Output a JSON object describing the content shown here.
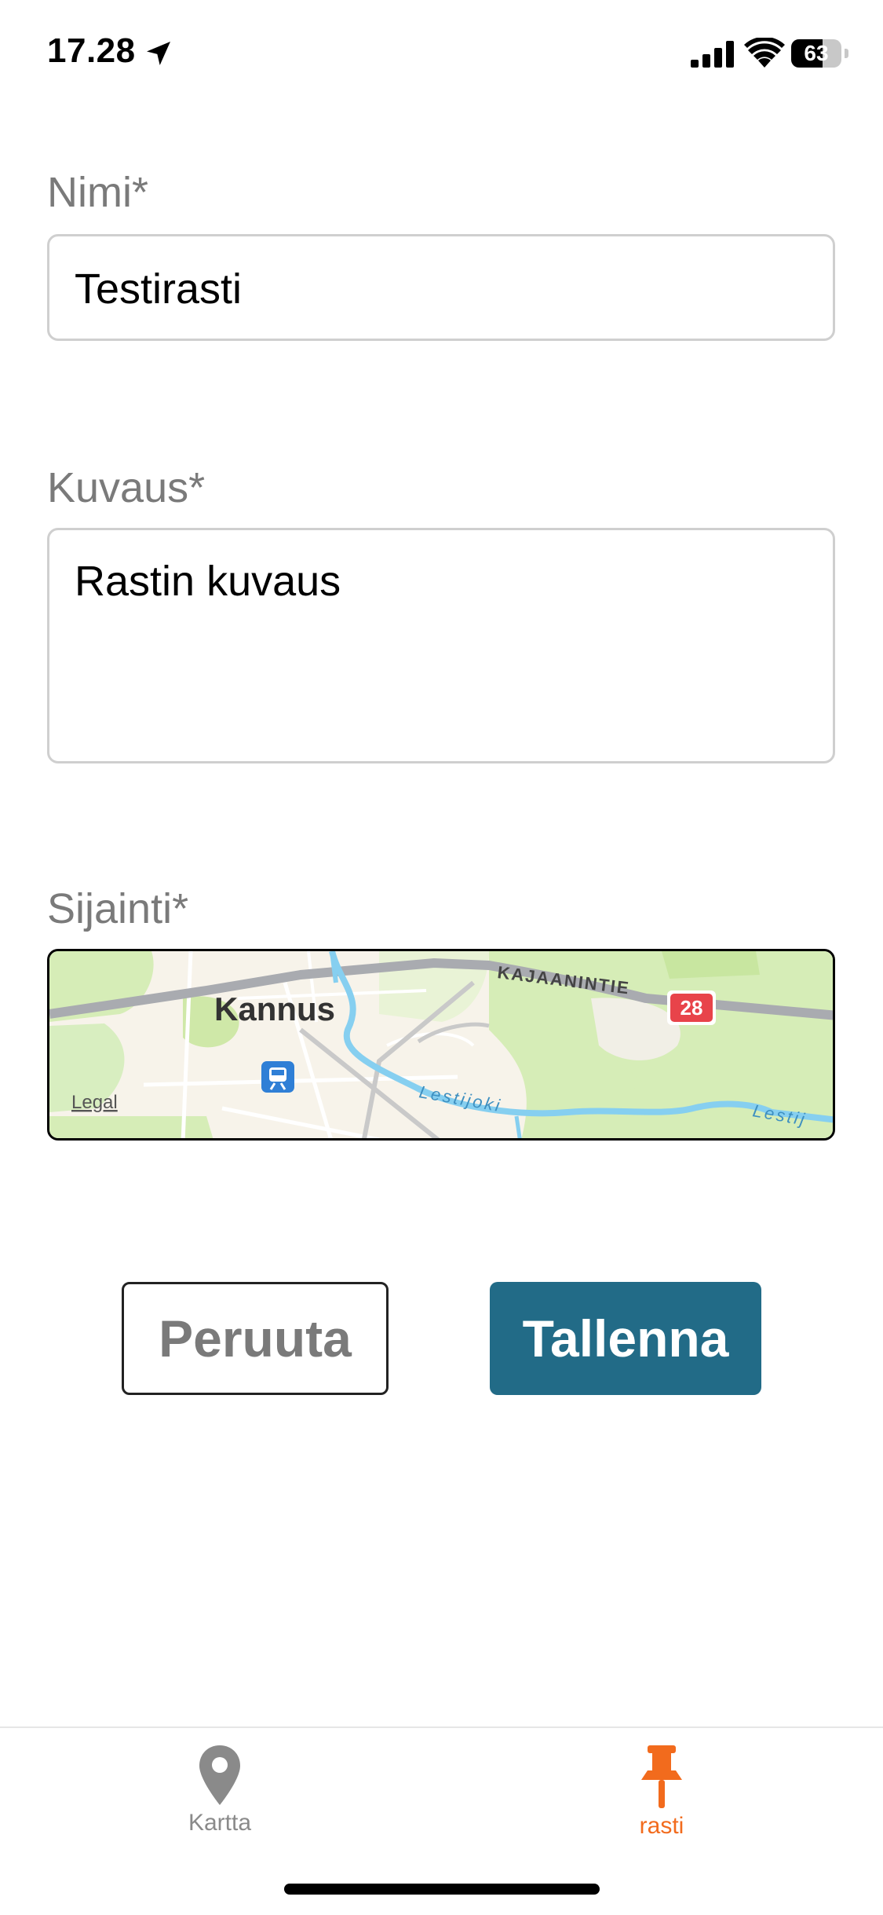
{
  "status_bar": {
    "time": "17.28",
    "battery_percent": 63,
    "battery_text": "63",
    "icons": [
      "location-arrow-icon",
      "cellular-signal-icon",
      "wifi-icon",
      "battery-icon"
    ]
  },
  "form": {
    "name": {
      "label": "Nimi*",
      "value": "Testirasti"
    },
    "description": {
      "label": "Kuvaus*",
      "value": "Rastin kuvaus"
    },
    "location": {
      "label": "Sijainti*",
      "map": {
        "town": "Kannus",
        "road": "KAJAANINTIE",
        "road_number": "28",
        "river_labels": [
          "Lestijoki",
          "Lestij"
        ],
        "legal": "Legal",
        "poi_icon": "train-station-icon"
      }
    }
  },
  "buttons": {
    "cancel": "Peruuta",
    "save": "Tallenna"
  },
  "tabbar": {
    "items": [
      {
        "label": "Kartta",
        "icon": "map-pin-icon",
        "active": false
      },
      {
        "label": "rasti",
        "icon": "pushpin-icon",
        "active": true
      }
    ]
  },
  "colors": {
    "accent": "#226b87",
    "active_tab": "#f26b1d",
    "inactive_tab": "#8a8a8a",
    "label": "#7a7a7a"
  }
}
